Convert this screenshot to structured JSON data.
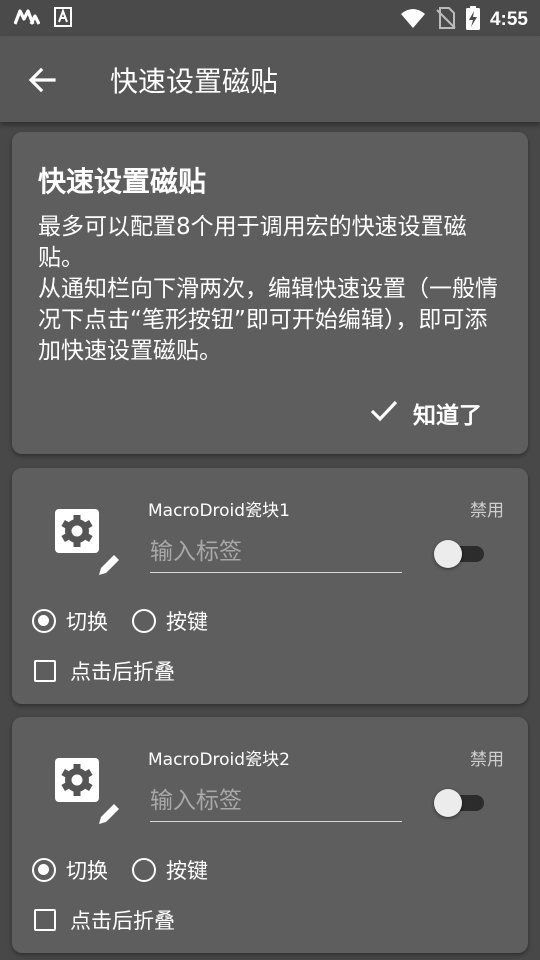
{
  "status_bar": {
    "time": "4:55",
    "left_icons": [
      "macrodroid-logo-icon",
      "font-app-icon"
    ],
    "right_icons": [
      "wifi-icon",
      "no-sim-icon",
      "battery-charging-icon"
    ]
  },
  "app_bar": {
    "title": "快速设置磁贴",
    "back_icon": "arrow-left-icon"
  },
  "info_card": {
    "title": "快速设置磁贴",
    "paragraphs": [
      "最多可以配置8个用于调用宏的快速设置磁贴。",
      "从通知栏向下滑两次，编辑快速设置（一般情况下点击“笔形按钮”即可开始编辑），即可添加快速设置磁贴。"
    ],
    "button_label": "知道了",
    "button_icon": "check-icon"
  },
  "tiles": [
    {
      "name": "MacroDroid瓷块1",
      "status": "禁用",
      "input_placeholder": "输入标签",
      "enabled": false,
      "radio_options": [
        "切换",
        "按键"
      ],
      "selected_option": "切换",
      "checkbox_label": "点击后折叠",
      "checkbox_checked": false
    },
    {
      "name": "MacroDroid瓷块2",
      "status": "禁用",
      "input_placeholder": "输入标签",
      "enabled": false,
      "radio_options": [
        "切换",
        "按键"
      ],
      "selected_option": "切换",
      "checkbox_label": "点击后折叠",
      "checkbox_checked": false
    }
  ],
  "colors": {
    "background": "#484848",
    "app_bar": "#575757",
    "card": "#5e5e5e",
    "text": "#ffffff"
  }
}
